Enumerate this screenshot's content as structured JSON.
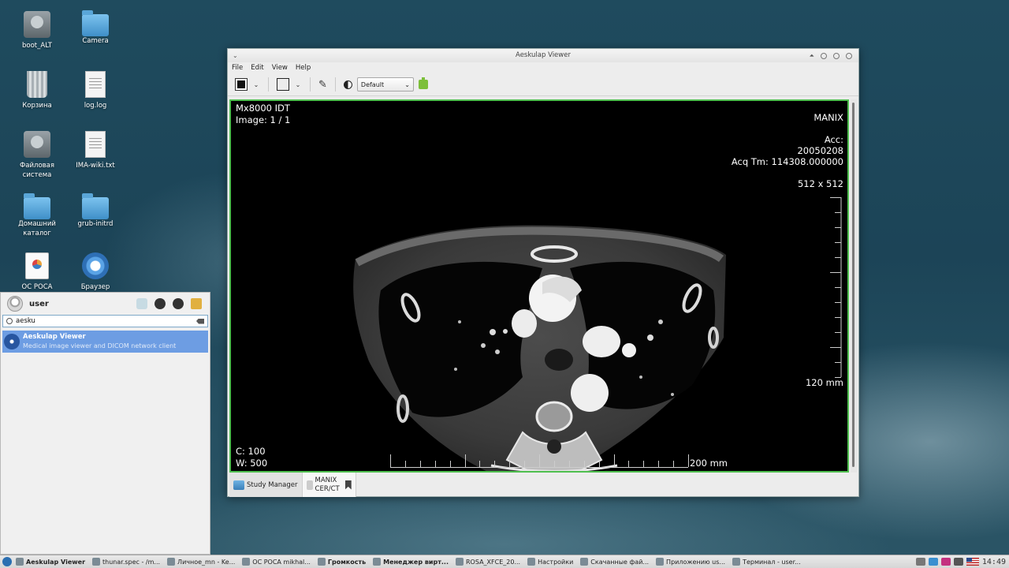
{
  "desktop": {
    "icons": [
      {
        "label": "boot_ALT",
        "icon": "drive-icon"
      },
      {
        "label": "Camera",
        "icon": "folder-icon"
      },
      {
        "label": "Корзина",
        "icon": "trash-icon"
      },
      {
        "label": "log.log",
        "icon": "document-icon"
      },
      {
        "label": "Файловая система",
        "icon": "drive-icon"
      },
      {
        "label": "IMA-wiki.txt",
        "icon": "document-icon"
      },
      {
        "label": "Домашний каталог",
        "icon": "home-folder-icon"
      },
      {
        "label": "grub-initrd",
        "icon": "folder-icon"
      },
      {
        "label": "ОС РОСА",
        "icon": "presentation-icon"
      },
      {
        "label": "Браузер",
        "icon": "browser-icon"
      }
    ]
  },
  "window": {
    "title": "Aeskulap Viewer",
    "menu": [
      "File",
      "Edit",
      "View",
      "Help"
    ],
    "toolbar": {
      "preset": "Default"
    },
    "overlay": {
      "top_left": [
        "Mx8000 IDT",
        "Image: 1 / 1"
      ],
      "institution": "MANIX",
      "acc_label": "Acc:",
      "date": "20050208",
      "acq_time": "Acq Tm: 114308.000000",
      "dimensions": "512 x 512",
      "v_scale_label": "120 mm",
      "h_scale_label": "200 mm",
      "center": "C: 100",
      "width": "W: 500"
    },
    "tabs": [
      {
        "label": "Study Manager"
      },
      {
        "label_line1": "MANIX",
        "label_line2": "CER/CT"
      }
    ]
  },
  "launcher": {
    "user": "user",
    "search_value": "aesku",
    "result_title": "Aeskulap Viewer",
    "result_desc": "Medical image viewer and DICOM network client"
  },
  "taskbar": {
    "items": [
      {
        "label": "Aeskulap Viewer",
        "active": true
      },
      {
        "label": "thunar.spec - /m..."
      },
      {
        "label": "Личное_mn - Ke..."
      },
      {
        "label": "ОС РОСА mikhal..."
      },
      {
        "label": "Громкость",
        "bold": true
      },
      {
        "label": "Менеджер вирт...",
        "bold": true
      },
      {
        "label": "ROSA_XFCE_20..."
      },
      {
        "label": "Настройки"
      },
      {
        "label": "Скачанные фай..."
      },
      {
        "label": "Приложению us..."
      },
      {
        "label": "Терминал - user..."
      }
    ],
    "clock": "14:49"
  }
}
